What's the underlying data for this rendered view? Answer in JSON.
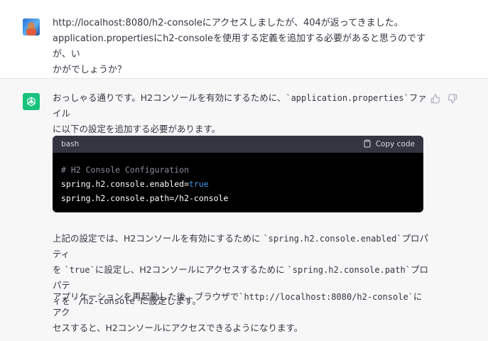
{
  "user_message": {
    "line1": "http://localhost:8080/h2-consoleにアクセスしましたが、404が返ってきました。",
    "line2": "application.propertiesにh2-consoleを使用する定義を追加する必要があると思うのですが、い",
    "line3": "かがでしょうか？"
  },
  "assistant_message": {
    "p1_a": "おっしゃる通りです。H2コンソールを有効にするために、",
    "p1_code": "`application.properties`",
    "p1_b": "ファイル",
    "p1_c": "に以下の設定を追加する必要があります。",
    "code_block": {
      "language": "bash",
      "copy_label": "Copy code",
      "comment": "# H2 Console Configuration",
      "line2_key": "spring.h2.console.enabled=",
      "line2_value": "true",
      "line3": "spring.h2.console.path=/h2-console"
    },
    "p2_a": "上記の設定では、H2コンソールを有効にするために ",
    "p2_code1": "`spring.h2.console.enabled`",
    "p2_b": "プロパティ",
    "p2_c": "を ",
    "p2_code2": "`true`",
    "p2_d": "に設定し、H2コンソールにアクセスするために ",
    "p2_code3": "`spring.h2.console.path`",
    "p2_e": "プロパテ",
    "p2_f": "ィを ",
    "p2_code4": "`/h2-console`",
    "p2_g": "に設定します。",
    "p3_a": "アプリケーションを再起動した後、ブラウザで",
    "p3_code": "`http://localhost:8080/h2-console`",
    "p3_b": "にアク",
    "p3_c": "セスすると、H2コンソールにアクセスできるようになります。"
  },
  "icons": {
    "user_avatar": "user-avatar-icon",
    "gpt_avatar": "openai-logo-icon",
    "thumbs_up": "thumbs-up-icon",
    "thumbs_down": "thumbs-down-icon",
    "copy": "clipboard-icon"
  },
  "colors": {
    "gpt_green": "#19c37d",
    "code_bg": "#000000",
    "code_header_bg": "#343541",
    "assistant_bg": "#f7f7f8",
    "keyword_blue": "#3d9be9"
  }
}
